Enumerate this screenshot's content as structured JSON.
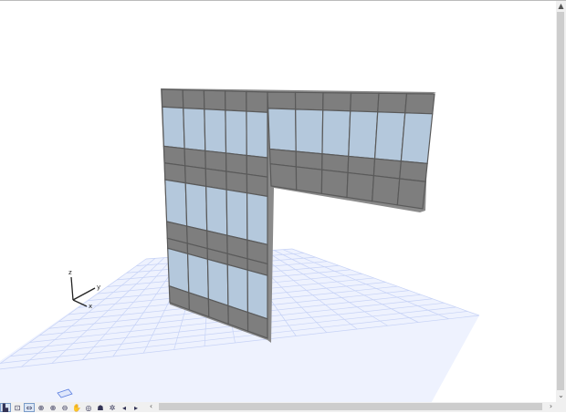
{
  "axes": {
    "x": "x",
    "y": "y",
    "z": "z"
  },
  "toolbar": [
    {
      "name": "plan-view-icon",
      "glyph": "▙"
    },
    {
      "name": "zoom-window-icon",
      "glyph": "⊡"
    },
    {
      "name": "fit-in-window-icon",
      "glyph": "⇔"
    },
    {
      "name": "zoom-in-icon",
      "glyph": "⊕"
    },
    {
      "name": "zoom-magnify-icon",
      "glyph": "⊕"
    },
    {
      "name": "zoom-out-icon",
      "glyph": "⊖"
    },
    {
      "name": "pan-hand-icon",
      "glyph": "✋"
    },
    {
      "name": "orbit-icon",
      "glyph": "◎"
    },
    {
      "name": "walk-icon",
      "glyph": "☗"
    },
    {
      "name": "explore-icon",
      "glyph": "✲"
    },
    {
      "name": "previous-view-icon",
      "glyph": "◂"
    },
    {
      "name": "next-view-icon",
      "glyph": "▸"
    }
  ],
  "scroll": {
    "up": "▲",
    "down": "⌄",
    "left": "‹",
    "right": "›"
  }
}
